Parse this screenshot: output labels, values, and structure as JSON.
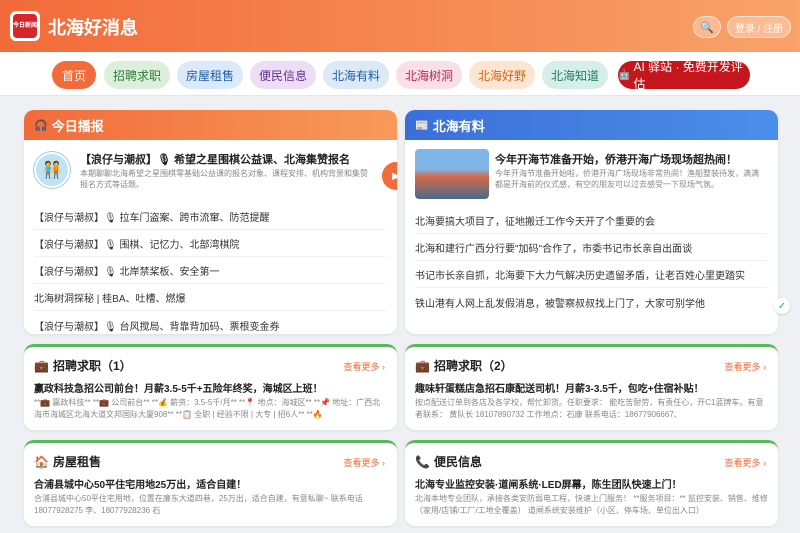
{
  "header": {
    "logo_text": "今日新闻",
    "title": "北海好消息",
    "search_icon": "🔍",
    "login_label": "登录 / 注册"
  },
  "nav": {
    "items": [
      {
        "label": "首页"
      },
      {
        "label": "招聘求职"
      },
      {
        "label": "房屋租售"
      },
      {
        "label": "便民信息"
      },
      {
        "label": "北海有料"
      },
      {
        "label": "北海树洞"
      },
      {
        "label": "北海好野"
      },
      {
        "label": "北海知道"
      },
      {
        "label": "AI 驿站 · 免费开发评估"
      }
    ]
  },
  "today": {
    "icon": "🎧",
    "title": "今日播报",
    "featured": {
      "title": "【浪仔与潮叔】🎙 希望之星围棋公益课、北海集赞报名",
      "desc": "本期聊聊北海希望之星围棋零基础公益课的报名对象、课程安排、机构背景和集赞报名方式等话题。",
      "play_icon": "▶"
    },
    "items": [
      "【浪仔与潮叔】🎙 拉车门盗案、跨市流窜、防范提醒",
      "【浪仔与潮叔】🎙 围棋、记忆力、北部湾棋院",
      "【浪仔与潮叔】🎙 北岸禁桨板、安全第一",
      "北海树洞探秘 | 桂BA、吐槽、燃爆",
      "【浪仔与潮叔】🎙 台风搅局、背靠背加码、票根变金券"
    ]
  },
  "youliao": {
    "icon": "📰",
    "title": "北海有料",
    "featured": {
      "title": "今年开海节准备开始，侨港开海广场现场超热闹！",
      "desc": "今年开海节准备开始啦，侨港开海广场现场非常热闹！渔船整装待发，满满都是开海前的仪式感，有空的朋友可以过去感受一下现场气氛。"
    },
    "items": [
      "北海要搞大项目了，征地搬迁工作今天开了个重要的会",
      "北海和建行广西分行要\"加码\"合作了，市委书记市长亲自出面谈",
      "书记市长亲自抓，北海要下大力气解决历史遗留矛盾，让老百姓心里更踏实",
      "铁山港有人网上乱发假消息，被警察叔叔找上门了，大家可别学他"
    ]
  },
  "sections": [
    {
      "icon": "💼",
      "title": "招聘求职（1）",
      "more": "查看更多 ›",
      "headline": "赢政科技急招公司前台！月薪3.5-5千+五险年终奖，海城区上班！",
      "body": "**💼 赢政科技** **💼 公司前台** **💰 薪资：3.5-5千/月** **📍 地点：海城区** **📌 地址：广西北海市海城区北海大道文邦国际大厦908** **📋 全职 | 经验不限 | 大专 | 招6人** **🔥"
    },
    {
      "icon": "💼",
      "title": "招聘求职（2）",
      "more": "查看更多 ›",
      "headline": "趣味轩蛋糕店急招石康配送司机！月薪3-3.5千，包吃+住宿补贴！",
      "body": "按点配送订单到各店及各学校，帮忙卸货。任职要求： 能吃苦耐劳，有责任心，开C1蓝牌车。有意者联系： 黄队长 18107890732 工作地点：石康 联系电话：18677906667、"
    },
    {
      "icon": "🏠",
      "title": "房屋租售",
      "more": "查看更多 ›",
      "headline": "合浦县城中心50平住宅用地25万出，适合自建！",
      "body": "合浦县城中心50平住宅用地，位置在廉东大道四巷，25万出，适合自建，有意私聊~ 联系电话 18077928275 李、18077928236 石"
    },
    {
      "icon": "📞",
      "title": "便民信息",
      "more": "查看更多 ›",
      "headline": "北海专业监控安装·道闸系统·LED屏幕，陈生团队快速上门！",
      "body": "北海本地专业团队，承接各类安防弱电工程，快速上门服务！ **服务项目：** 监控安装、销售、维修（家用/店铺/工厂/工地全覆盖） 道闸系统安装维护（小区、停车场、单位出入口）"
    }
  ],
  "float_badge": "✓"
}
